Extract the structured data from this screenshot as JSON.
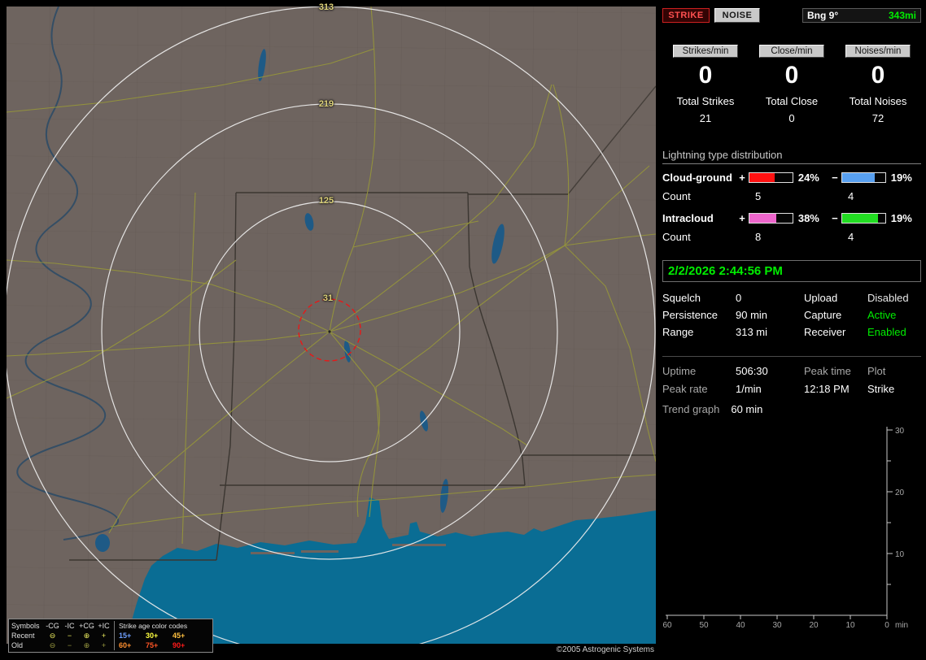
{
  "map": {
    "range_labels": [
      "313",
      "219",
      "125",
      "31"
    ],
    "copyright": "©2005 Astrogenic Systems",
    "legend": {
      "title_symbols": "Symbols",
      "col_headers": [
        "-CG",
        "-IC",
        "+CG",
        "+IC"
      ],
      "age_title": "Strike age color codes",
      "rows": [
        {
          "label": "Recent",
          "symbols": [
            "⊖",
            "−",
            "⊕",
            "+"
          ],
          "symbol_color": "#f0f060",
          "ages": [
            {
              "t": "15+",
              "c": "#6f9fff"
            },
            {
              "t": "30+",
              "c": "#ffff40"
            },
            {
              "t": "45+",
              "c": "#ffc040"
            }
          ]
        },
        {
          "label": "Old",
          "symbols": [
            "⊖",
            "−",
            "⊕",
            "+"
          ],
          "symbol_color": "#9a9a40",
          "ages": [
            {
              "t": "60+",
              "c": "#ff9030"
            },
            {
              "t": "75+",
              "c": "#ff5525"
            },
            {
              "t": "90+",
              "c": "#ff1a1a"
            }
          ]
        }
      ]
    }
  },
  "panel": {
    "strike_button": "STRIKE",
    "noise_button": "NOISE",
    "bearing_label": "Bng 9°",
    "bearing_range": "343mi",
    "counters": [
      {
        "label": "Strikes/min",
        "value": "0",
        "total_label": "Total Strikes",
        "total": "21"
      },
      {
        "label": "Close/min",
        "value": "0",
        "total_label": "Total Close",
        "total": "0"
      },
      {
        "label": "Noises/min",
        "value": "0",
        "total_label": "Total Noises",
        "total": "72"
      }
    ],
    "distribution": {
      "title": "Lightning type distribution",
      "plus_sign": "+",
      "minus_sign": "−",
      "count_label": "Count",
      "rows": [
        {
          "name": "Cloud-ground",
          "plus_pct": "24%",
          "plus_color": "#ff1111",
          "plus_fill": "58%",
          "minus_pct": "19%",
          "minus_color": "#58a0f0",
          "minus_fill": "76%",
          "plus_count": "5",
          "minus_count": "4"
        },
        {
          "name": "Intracloud",
          "plus_pct": "38%",
          "plus_color": "#ee66cc",
          "plus_fill": "62%",
          "minus_pct": "19%",
          "minus_color": "#22dd22",
          "minus_fill": "84%",
          "plus_count": "8",
          "minus_count": "4"
        }
      ]
    },
    "timestamp": "2/2/2026 2:44:56 PM",
    "settings": [
      {
        "label": "Squelch",
        "value": "0",
        "label2": "Upload",
        "value2": "Disabled",
        "value2_color": "#e8e8e8"
      },
      {
        "label": "Persistence",
        "value": "90 min",
        "label2": "Capture",
        "value2": "Active",
        "value2_color": "#00ee00"
      },
      {
        "label": "Range",
        "value": "313 mi",
        "label2": "Receiver",
        "value2": "Enabled",
        "value2_color": "#00ee00"
      }
    ],
    "stats": {
      "uptime_label": "Uptime",
      "uptime_value": "506:30",
      "peak_time_label": "Peak time",
      "plot_label": "Plot",
      "peak_rate_label": "Peak rate",
      "peak_rate_value": "1/min",
      "peak_time_value": "12:18 PM",
      "plot_value": "Strike",
      "trend_label": "Trend graph",
      "trend_value": "60 min"
    },
    "trend_graph": {
      "y_ticks": [
        "30",
        "20",
        "10"
      ],
      "x_ticks": [
        "60",
        "50",
        "40",
        "30",
        "20",
        "10",
        "0"
      ],
      "x_unit": "min"
    }
  }
}
